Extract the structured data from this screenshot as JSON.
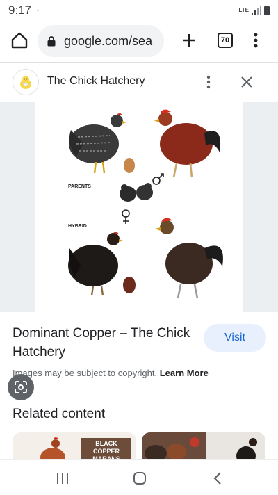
{
  "status": {
    "time": "9:17",
    "network": "LTE"
  },
  "browser": {
    "url": "google.com/sea",
    "tab_count": "70"
  },
  "panel": {
    "site_name": "The Chick Hatchery"
  },
  "image": {
    "parents_label": "PARENTS",
    "hybrid_label": "HYBRID"
  },
  "result": {
    "title": "Dominant Copper – The Chick Hatchery",
    "visit_label": "Visit",
    "copyright_text": "Images may be subject to copyright.",
    "learn_more": "Learn More"
  },
  "related": {
    "title": "Related content",
    "thumb1_caption": "BLACK COPPER MARANS"
  },
  "colors": {
    "accent": "#1967d2",
    "visit_bg": "#e8f0fe"
  }
}
